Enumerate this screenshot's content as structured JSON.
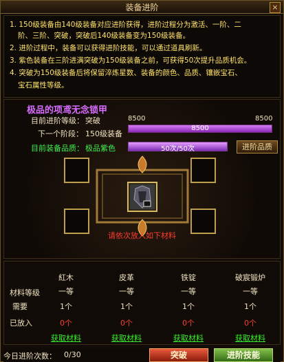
{
  "window": {
    "title": "装备进阶",
    "close_label": "×"
  },
  "notes": [
    "1. 150级装备由140级装备对应进阶获得，进阶过程分为激活、一阶、二",
    "阶、三阶、突破，突破后140级装备变为150级装备。",
    "2. 进阶过程中，装备可以获得进阶技能，可以通过道具刷新。",
    "3. 紫色装备在三阶进满突破为150级装备之前，可获得50次提升品质机会。",
    "4. 突破为150级装备后将保留淬炼星数、装备的颜色、品质、镶嵌宝石、",
    "宝石属性等级。"
  ],
  "equipment": {
    "name": "极品的项鸢无念锁甲",
    "current_stage_label": "目前进阶等级：",
    "current_stage": "突破",
    "next_stage_label": "下一个阶段：",
    "next_stage": "150级装备",
    "progress": {
      "left": "8500",
      "right": "8500",
      "text": "8500",
      "fraction": 1.0
    },
    "quality_label": "目前装备品质：",
    "quality_value": "极品紫色",
    "quality_bar_text": "50次/50次",
    "quality_fraction": 1.0,
    "advance_quality_button": "进阶品质"
  },
  "hint": "请依次放入如下材料",
  "materials": {
    "row_labels": [
      "材料等级",
      "需要",
      "已放入"
    ],
    "items": [
      {
        "name": "紅木",
        "level": "一等",
        "need": "1个",
        "have": "0个",
        "get": "获取材料"
      },
      {
        "name": "皮革",
        "level": "一等",
        "need": "1个",
        "have": "0个",
        "get": "获取材料"
      },
      {
        "name": "铁锭",
        "level": "一等",
        "need": "1个",
        "have": "0个",
        "get": "获取材料"
      },
      {
        "name": "破宸锻炉",
        "level": "一等",
        "need": "1个",
        "have": "0个",
        "get": "获取材料"
      }
    ]
  },
  "footer": {
    "daily_label": "今日进阶次数：",
    "daily_value": "0/30",
    "breakthrough_button": "突破",
    "advance_skill_button": "进阶技能"
  },
  "colors": {
    "note_text": "#ffe36a",
    "purple": "#d86cff",
    "green_link": "#38f02a",
    "hint_red": "#ff3b2d"
  }
}
